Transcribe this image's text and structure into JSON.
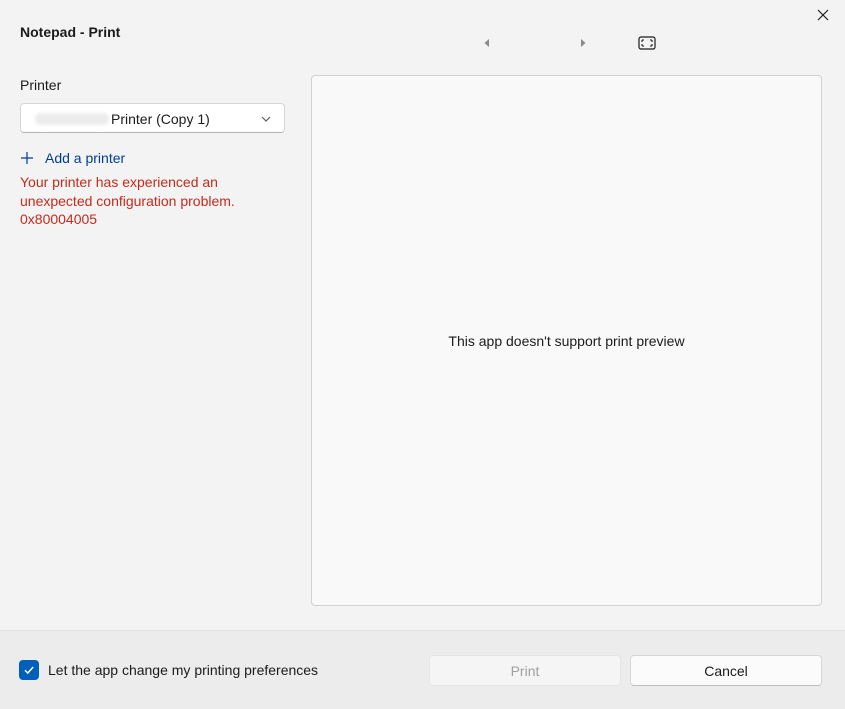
{
  "window": {
    "title": "Notepad - Print"
  },
  "printer": {
    "label": "Printer",
    "selected_value": "Printer (Copy 1)",
    "add_printer_label": "Add a printer",
    "error_message": "Your printer has experienced an unexpected configuration problem. 0x80004005"
  },
  "preview": {
    "message": "This app doesn't support print preview"
  },
  "footer": {
    "checkbox_label": "Let the app change my printing preferences",
    "checkbox_checked": true,
    "print_label": "Print",
    "cancel_label": "Cancel"
  },
  "icons": {
    "close": "close-icon",
    "prev_page": "caret-left-icon",
    "next_page": "caret-right-icon",
    "fit_page": "fit-page-icon",
    "dropdown": "chevron-down-icon",
    "add": "plus-icon",
    "check": "checkmark-icon"
  },
  "colors": {
    "accent": "#005fb8",
    "error": "#c42b1c",
    "link": "#003e92"
  }
}
